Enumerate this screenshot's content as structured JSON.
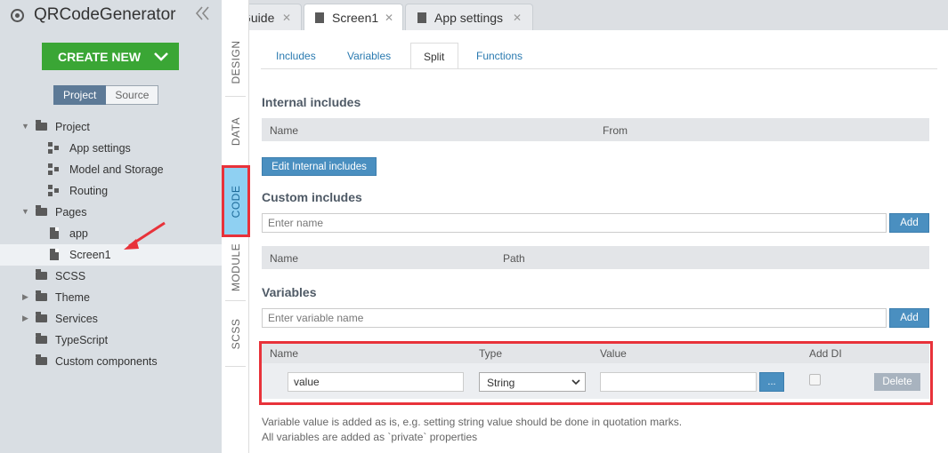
{
  "app": {
    "title": "QRCodeGenerator",
    "collapse_icon": "double-chevron-left-icon"
  },
  "sidebar": {
    "create_button": "CREATE NEW",
    "toggle": [
      "Project",
      "Source"
    ],
    "tree": [
      {
        "label": "Project"
      },
      {
        "label": "App settings"
      },
      {
        "label": "Model and Storage"
      },
      {
        "label": "Routing"
      },
      {
        "label": "Pages"
      },
      {
        "label": "app"
      },
      {
        "label": "Screen1"
      },
      {
        "label": "SCSS"
      },
      {
        "label": "Theme"
      },
      {
        "label": "Services"
      },
      {
        "label": "TypeScript"
      },
      {
        "label": "Custom components"
      }
    ]
  },
  "vertical_tabs": [
    "DESIGN",
    "DATA",
    "CODE",
    "MODULE",
    "SCSS"
  ],
  "file_tabs": [
    "Guide",
    "Screen1",
    "App settings"
  ],
  "sub_tabs": [
    "Includes",
    "Variables",
    "Split",
    "Functions"
  ],
  "internal_includes": {
    "title": "Internal includes",
    "columns": [
      "Name",
      "From"
    ],
    "edit_button": "Edit Internal includes"
  },
  "custom_includes": {
    "title": "Custom includes",
    "placeholder": "Enter name",
    "add_button": "Add",
    "columns": [
      "Name",
      "Path"
    ]
  },
  "variables": {
    "title": "Variables",
    "placeholder": "Enter variable name",
    "add_button": "Add",
    "columns": [
      "Name",
      "Type",
      "Value",
      "Add DI"
    ],
    "row": {
      "name": "value",
      "type": "String",
      "value": "",
      "more_button": "...",
      "delete_button": "Delete"
    }
  },
  "notes": [
    "Variable value is added as is, e.g. setting string value should be done in quotation marks.",
    "All variables are added as `private` properties"
  ],
  "colors": {
    "accent_green": "#3aa635",
    "accent_blue": "#4a8fc0",
    "highlight_red": "#e8323a",
    "active_vtab": "#8fd0f2"
  }
}
